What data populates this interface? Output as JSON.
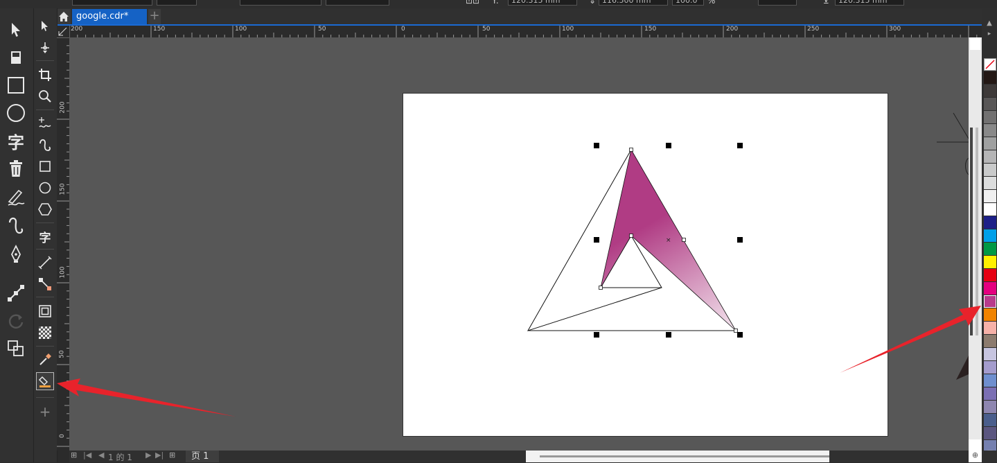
{
  "property_bar": {
    "y_label": "Y:",
    "y_value": "120.315 mm",
    "height_value": "116.500 mm",
    "scale_value": "100.0",
    "scale_unit": "%",
    "extra_value": "120.315 mm"
  },
  "document_tabs": [
    {
      "label": "google.cdr*",
      "active": true
    }
  ],
  "toolbar_primary": [
    "pick-tool",
    "eraser-tool",
    "rectangle-tool",
    "ellipse-tool",
    "text-tool",
    "trash-tool",
    "artistic-media-tool",
    "bspline-tool",
    "pen-tool",
    "connector-tool",
    "rotate-tool",
    "transform-tool"
  ],
  "toolbar_secondary": [
    "pick-tool",
    "shape-tool",
    "crop-tool",
    "zoom-tool",
    "freehand-tool",
    "bspline-tool",
    "rectangle-tool",
    "ellipse-tool",
    "polygon-tool",
    "text-tool",
    "dimension-tool",
    "connector-tool",
    "contour-tool",
    "transparency-tool",
    "eyedropper-tool",
    "interactive-fill-tool",
    "add-tool"
  ],
  "text_tool_glyph": "字",
  "ruler": {
    "horizontal_labels": [
      "200",
      "150",
      "100",
      "50",
      "0",
      "50",
      "100",
      "150",
      "200",
      "250",
      "300"
    ],
    "vertical_labels": [
      "200",
      "150",
      "100",
      "50",
      "0"
    ]
  },
  "palette_colors": [
    "#ffffff",
    "#231815",
    "#3e3a39",
    "#595757",
    "#727171",
    "#898989",
    "#9fa0a0",
    "#b5b5b6",
    "#c9caca",
    "#dcdddd",
    "#efefef",
    "#ffffff",
    "#1d2088",
    "#00a0e9",
    "#009944",
    "#fff100",
    "#e60012",
    "#e4007f",
    "#b83b8c",
    "#f08300",
    "#f6b1a8",
    "#8c7b6e",
    "#c7c5e0",
    "#a49ccd",
    "#6f8fcf",
    "#7b6fb4",
    "#8e86b0",
    "#4a5e8c",
    "#5b5680",
    "#7580b0"
  ],
  "selected_fill": "#b83b8c",
  "status": {
    "page_of_label": "1 的 1",
    "page_tab": "页 1"
  },
  "annotations": {
    "arrow_color": "#e8232b"
  }
}
